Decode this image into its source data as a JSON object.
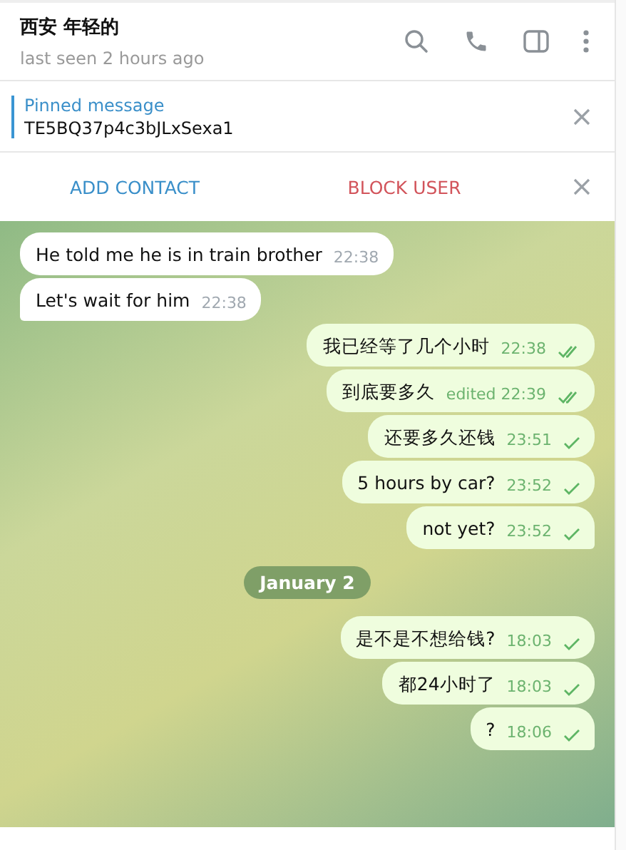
{
  "header": {
    "title": "西安 年轻的",
    "status": "last seen 2 hours ago"
  },
  "pinned": {
    "label": "Pinned message",
    "text": "TE5BQ37p4c3bJLxSexa1"
  },
  "actions": {
    "add": "ADD CONTACT",
    "block": "BLOCK USER"
  },
  "messages": [
    {
      "kind": "message",
      "outgoing": false,
      "text": "He told me he is in train brother",
      "time": "22:38"
    },
    {
      "kind": "message",
      "outgoing": false,
      "text": "Let's wait for him",
      "time": "22:38"
    },
    {
      "kind": "message",
      "outgoing": true,
      "text": "我已经等了几个小时",
      "time": "22:38",
      "read": true
    },
    {
      "kind": "message",
      "outgoing": true,
      "text": "到底要多久",
      "time": "edited 22:39",
      "read": true
    },
    {
      "kind": "message",
      "outgoing": true,
      "text": "还要多久还钱",
      "time": "23:51",
      "read": false
    },
    {
      "kind": "message",
      "outgoing": true,
      "text": "5 hours by car?",
      "time": "23:52",
      "read": false
    },
    {
      "kind": "message",
      "outgoing": true,
      "text": "not yet?",
      "time": "23:52",
      "read": false
    },
    {
      "kind": "date",
      "text": "January 2"
    },
    {
      "kind": "message",
      "outgoing": true,
      "text": "是不是不想给钱?",
      "time": "18:03",
      "read": false
    },
    {
      "kind": "message",
      "outgoing": true,
      "text": "都24小时了",
      "time": "18:03",
      "read": false
    },
    {
      "kind": "message",
      "outgoing": true,
      "text": "?",
      "time": "18:06",
      "read": false
    }
  ]
}
